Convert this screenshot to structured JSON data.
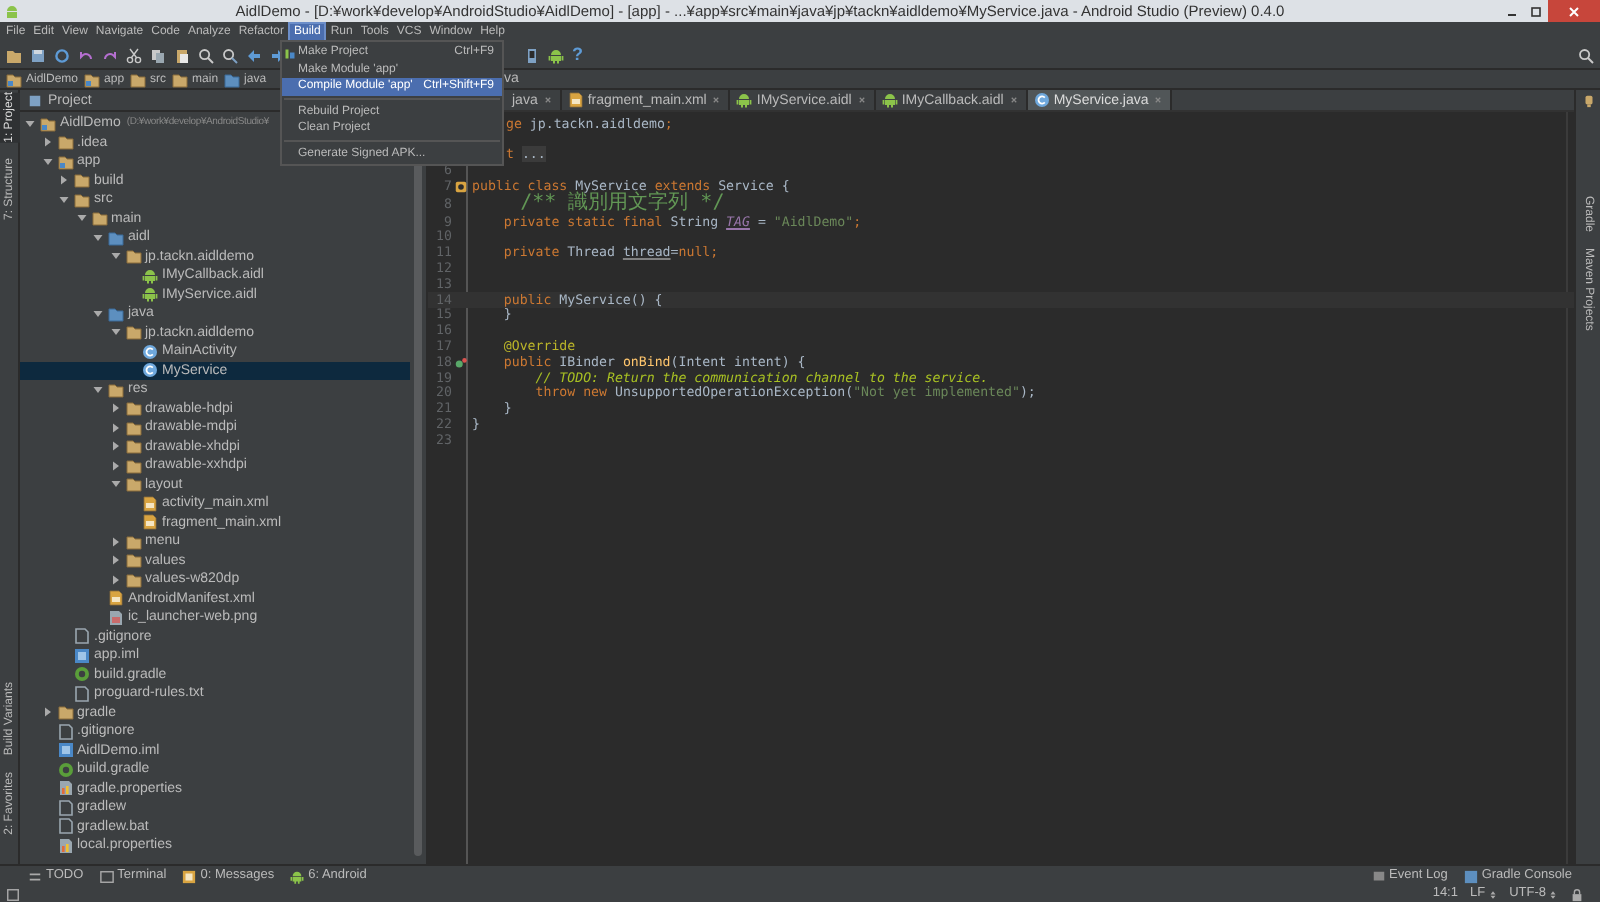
{
  "window": {
    "title": "AidlDemo - [D:¥work¥develop¥AndroidStudio¥AidlDemo] - [app] - ...¥app¥src¥main¥java¥jp¥tackn¥aidldemo¥MyService.java - Android Studio (Preview) 0.4.0"
  },
  "menu_bar": [
    {
      "label": "File",
      "selected": false
    },
    {
      "label": "Edit",
      "selected": false
    },
    {
      "label": "View",
      "selected": false
    },
    {
      "label": "Navigate",
      "selected": false
    },
    {
      "label": "Code",
      "selected": false
    },
    {
      "label": "Analyze",
      "selected": false
    },
    {
      "label": "Refactor",
      "selected": false
    },
    {
      "label": "Build",
      "selected": true
    },
    {
      "label": "Run",
      "selected": false
    },
    {
      "label": "Tools",
      "selected": false
    },
    {
      "label": "VCS",
      "selected": false
    },
    {
      "label": "Window",
      "selected": false
    },
    {
      "label": "Help",
      "selected": false
    }
  ],
  "build_menu": [
    {
      "kind": "item",
      "label": "Make Project",
      "shortcut": "Ctrl+F9",
      "selected": false
    },
    {
      "kind": "item",
      "label": "Make Module 'app'",
      "selected": false
    },
    {
      "kind": "item",
      "label": "Compile Module 'app'",
      "shortcut": "Ctrl+Shift+F9",
      "selected": true
    },
    {
      "kind": "separator"
    },
    {
      "kind": "item",
      "label": "Rebuild Project",
      "selected": false
    },
    {
      "kind": "item",
      "label": "Clean Project",
      "selected": false
    },
    {
      "kind": "separator"
    },
    {
      "kind": "item",
      "label": "Generate Signed APK...",
      "selected": false
    }
  ],
  "toolbar": {
    "help": "?"
  },
  "breadcrumbs": [
    {
      "label": "AidlDemo",
      "kind": "module"
    },
    {
      "label": "app",
      "kind": "module"
    },
    {
      "label": "src",
      "kind": "folder"
    },
    {
      "label": "main",
      "kind": "folder"
    },
    {
      "label": "java",
      "kind": "source"
    }
  ],
  "breadcrumb_tail": "va",
  "left_tool_tabs_top": [
    {
      "label": "1: Project",
      "selected": true
    },
    {
      "label": "7: Structure",
      "selected": false
    }
  ],
  "left_tool_tabs_bottom": [
    {
      "label": "Build Variants",
      "selected": false
    },
    {
      "label": "2: Favorites",
      "selected": false
    }
  ],
  "project_panel": {
    "title": "Project",
    "tree": [
      {
        "label": "AidlDemo",
        "path": "(D:¥work¥develop¥AndroidStudio¥",
        "kind": "module",
        "expanded": true,
        "selected": false,
        "children": [
          {
            "label": ".idea",
            "kind": "folder",
            "expanded": false,
            "selected": false
          },
          {
            "label": "app",
            "kind": "module",
            "expanded": true,
            "selected": false,
            "children": [
              {
                "label": "build",
                "kind": "folder",
                "expanded": false,
                "selected": false
              },
              {
                "label": "src",
                "kind": "folder",
                "expanded": true,
                "selected": false,
                "children": [
                  {
                    "label": "main",
                    "kind": "folder",
                    "expanded": true,
                    "selected": false,
                    "children": [
                      {
                        "label": "aidl",
                        "kind": "source",
                        "expanded": true,
                        "selected": false,
                        "children": [
                          {
                            "label": "jp.tackn.aidldemo",
                            "kind": "package",
                            "expanded": true,
                            "selected": false,
                            "children": [
                              {
                                "label": "IMyCallback.aidl",
                                "kind": "android",
                                "selected": false
                              },
                              {
                                "label": "IMyService.aidl",
                                "kind": "android",
                                "selected": false
                              }
                            ]
                          }
                        ]
                      },
                      {
                        "label": "java",
                        "kind": "source",
                        "expanded": true,
                        "selected": false,
                        "children": [
                          {
                            "label": "jp.tackn.aidldemo",
                            "kind": "package",
                            "expanded": true,
                            "selected": false,
                            "children": [
                              {
                                "label": "MainActivity",
                                "kind": "class",
                                "selected": false
                              },
                              {
                                "label": "MyService",
                                "kind": "class",
                                "selected": true
                              }
                            ]
                          }
                        ]
                      },
                      {
                        "label": "res",
                        "kind": "folder",
                        "expanded": true,
                        "selected": false,
                        "children": [
                          {
                            "label": "drawable-hdpi",
                            "kind": "package",
                            "expanded": false,
                            "selected": false
                          },
                          {
                            "label": "drawable-mdpi",
                            "kind": "package",
                            "expanded": false,
                            "selected": false
                          },
                          {
                            "label": "drawable-xhdpi",
                            "kind": "package",
                            "expanded": false,
                            "selected": false
                          },
                          {
                            "label": "drawable-xxhdpi",
                            "kind": "package",
                            "expanded": false,
                            "selected": false
                          },
                          {
                            "label": "layout",
                            "kind": "package",
                            "expanded": true,
                            "selected": false,
                            "children": [
                              {
                                "label": "activity_main.xml",
                                "kind": "xml",
                                "selected": false
                              },
                              {
                                "label": "fragment_main.xml",
                                "kind": "xml",
                                "selected": false
                              }
                            ]
                          },
                          {
                            "label": "menu",
                            "kind": "package",
                            "expanded": false,
                            "selected": false
                          },
                          {
                            "label": "values",
                            "kind": "package",
                            "expanded": false,
                            "selected": false
                          },
                          {
                            "label": "values-w820dp",
                            "kind": "package",
                            "expanded": false,
                            "selected": false
                          }
                        ]
                      },
                      {
                        "label": "AndroidManifest.xml",
                        "kind": "xml",
                        "selected": false
                      },
                      {
                        "label": "ic_launcher-web.png",
                        "kind": "image",
                        "selected": false
                      }
                    ]
                  }
                ]
              },
              {
                "label": ".gitignore",
                "kind": "file",
                "selected": false
              },
              {
                "label": "app.iml",
                "kind": "iml",
                "selected": false
              },
              {
                "label": "build.gradle",
                "kind": "gradle",
                "selected": false
              },
              {
                "label": "proguard-rules.txt",
                "kind": "file",
                "selected": false
              }
            ]
          },
          {
            "label": "gradle",
            "kind": "folder",
            "expanded": false,
            "selected": false
          },
          {
            "label": ".gitignore",
            "kind": "file",
            "selected": false
          },
          {
            "label": "AidlDemo.iml",
            "kind": "iml",
            "selected": false
          },
          {
            "label": "build.gradle",
            "kind": "gradle",
            "selected": false
          },
          {
            "label": "gradle.properties",
            "kind": "properties",
            "selected": false
          },
          {
            "label": "gradlew",
            "kind": "file",
            "selected": false
          },
          {
            "label": "gradlew.bat",
            "kind": "file",
            "selected": false
          },
          {
            "label": "local.properties",
            "kind": "properties",
            "selected": false
          }
        ]
      }
    ]
  },
  "editor_tabs": [
    {
      "label": "java",
      "selected": false
    },
    {
      "label": "fragment_main.xml",
      "kind": "xml",
      "selected": false
    },
    {
      "label": "IMyService.aidl",
      "kind": "android",
      "selected": false
    },
    {
      "label": "IMyCallback.aidl",
      "kind": "android",
      "selected": false
    },
    {
      "label": "MyService.java",
      "kind": "class",
      "selected": true
    }
  ],
  "code": {
    "lines": [
      {
        "kind": "clipped",
        "segments": [
          {
            "text": "ge ",
            "kind": "keyword"
          },
          {
            "text": "jp.tackn.aidldemo",
            "kind": "plain"
          },
          {
            "text": ";",
            "kind": "keyword"
          }
        ]
      },
      {
        "kind": "hidden"
      },
      {
        "kind": "clipped",
        "segments": [
          {
            "text": "t ",
            "kind": "keyword"
          },
          {
            "text": "...",
            "kind": "folded"
          }
        ]
      },
      {
        "kind": "numbered",
        "number": "6",
        "current": false
      },
      {
        "kind": "numbered",
        "number": "7",
        "current": false,
        "marker": {
          "kind": "override"
        },
        "segments": [
          {
            "text": "public class ",
            "kind": "keyword"
          },
          {
            "text": "MyService ",
            "kind": "plain"
          },
          {
            "text": "extends ",
            "kind": "keyword"
          },
          {
            "text": "Service {",
            "kind": "plain"
          }
        ]
      },
      {
        "kind": "numbered",
        "number": "8",
        "current": false,
        "segments": [
          {
            "text": "    /** 識別用文字列 */",
            "kind": "doc"
          }
        ]
      },
      {
        "kind": "numbered",
        "number": "9",
        "current": false,
        "segments": [
          {
            "text": "    private static final ",
            "kind": "keyword"
          },
          {
            "text": "String ",
            "kind": "plain"
          },
          {
            "text": "TAG",
            "kind": "field"
          },
          {
            "text": " = ",
            "kind": "plain"
          },
          {
            "text": "\"AidlDemo\"",
            "kind": "string"
          },
          {
            "text": ";",
            "kind": "keyword"
          }
        ]
      },
      {
        "kind": "numbered",
        "number": "10",
        "current": false
      },
      {
        "kind": "numbered",
        "number": "11",
        "current": false,
        "segments": [
          {
            "text": "    private ",
            "kind": "keyword"
          },
          {
            "text": "Thread ",
            "kind": "plain"
          },
          {
            "text": "thread",
            "kind": "unused"
          },
          {
            "text": "=",
            "kind": "plain"
          },
          {
            "text": "null;",
            "kind": "keyword"
          }
        ]
      },
      {
        "kind": "numbered",
        "number": "12",
        "current": false
      },
      {
        "kind": "numbered",
        "number": "13",
        "current": false
      },
      {
        "kind": "numbered",
        "number": "14",
        "current": true,
        "segments": [
          {
            "text": "    public ",
            "kind": "keyword"
          },
          {
            "text": "MyService() {",
            "kind": "plain"
          }
        ]
      },
      {
        "kind": "numbered",
        "number": "15",
        "current": false,
        "segments": [
          {
            "text": "    }",
            "kind": "plain"
          }
        ]
      },
      {
        "kind": "numbered",
        "number": "16",
        "current": false
      },
      {
        "kind": "numbered",
        "number": "17",
        "current": false,
        "segments": [
          {
            "text": "    @Override",
            "kind": "annotation"
          }
        ]
      },
      {
        "kind": "numbered",
        "number": "18",
        "current": false,
        "marker": {
          "kind": "implements"
        },
        "segments": [
          {
            "text": "    public ",
            "kind": "keyword"
          },
          {
            "text": "IBinder ",
            "kind": "plain"
          },
          {
            "text": "onBind",
            "kind": "method"
          },
          {
            "text": "(Intent intent) {",
            "kind": "plain"
          }
        ]
      },
      {
        "kind": "numbered",
        "number": "19",
        "current": false,
        "segments": [
          {
            "text": "        // TODO: Return the communication channel to the service.",
            "kind": "todo"
          }
        ]
      },
      {
        "kind": "numbered",
        "number": "20",
        "current": false,
        "segments": [
          {
            "text": "        throw new ",
            "kind": "keyword"
          },
          {
            "text": "UnsupportedOperationException(",
            "kind": "plain"
          },
          {
            "text": "\"Not yet implemented\"",
            "kind": "string"
          },
          {
            "text": ");",
            "kind": "plain"
          }
        ]
      },
      {
        "kind": "numbered",
        "number": "21",
        "current": false,
        "segments": [
          {
            "text": "    }",
            "kind": "plain"
          }
        ]
      },
      {
        "kind": "numbered",
        "number": "22",
        "current": false,
        "segments": [
          {
            "text": "}",
            "kind": "plain"
          }
        ]
      },
      {
        "kind": "numbered",
        "number": "23",
        "current": false
      }
    ]
  },
  "right_tool_tabs": [
    {
      "label": "Gradle"
    },
    {
      "label": "Maven Projects"
    }
  ],
  "bottom_tool_tabs": [
    {
      "label": "TODO",
      "kind": "todo"
    },
    {
      "label": "Terminal",
      "kind": "terminal"
    },
    {
      "label": "0: Messages",
      "kind": "messages"
    },
    {
      "label": "6: Android",
      "kind": "android"
    }
  ],
  "bottom_right_tabs": [
    {
      "label": "Event Log",
      "kind": "log"
    },
    {
      "label": "Gradle Console",
      "kind": "console"
    }
  ],
  "status_bar": {
    "caret": "14:1",
    "line_separator": "LF",
    "encoding": "UTF-8"
  }
}
